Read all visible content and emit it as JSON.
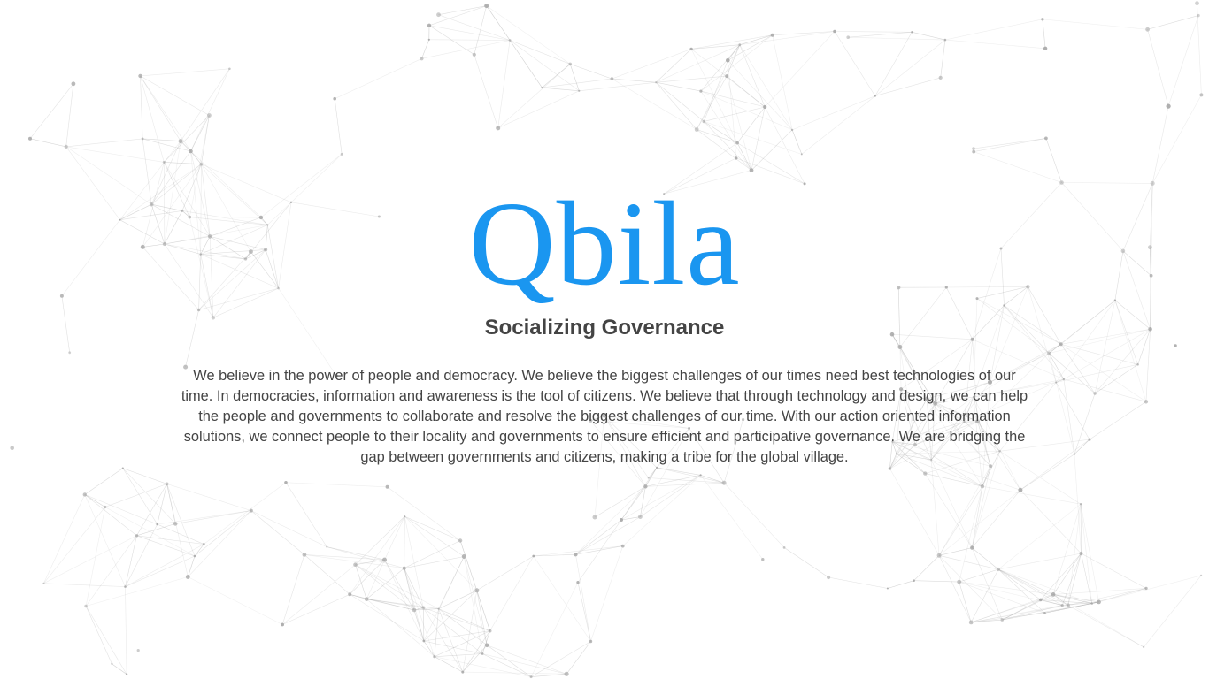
{
  "brand": {
    "name": "Qbila",
    "color": "#1a96f0"
  },
  "tagline": "Socializing Governance",
  "mission": "We believe in the power of people and democracy. We believe the biggest challenges of our times need best technologies of our time. In democracies, information and awareness is the tool of citizens. We believe that through technology and design, we can help the people and governments to collaborate and resolve the biggest challenges of our time. With our action oriented information solutions, we connect people to their locality and governments to ensure efficient and participative governance. We are bridging the gap between governments and citizens, making a tribe for the global village.",
  "background": {
    "style": "network-mesh",
    "line_color": "#9a9a9a",
    "node_color": "#a6a6a6"
  }
}
